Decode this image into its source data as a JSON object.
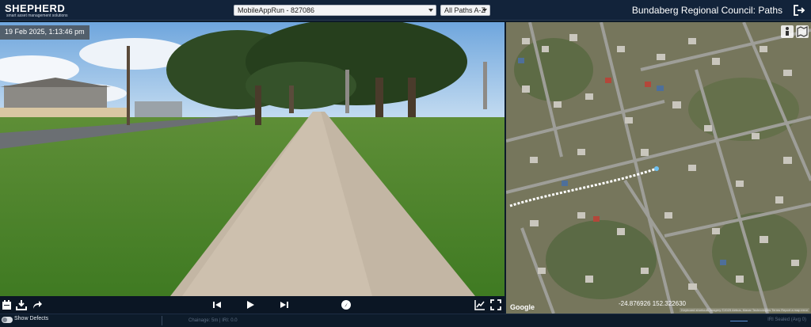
{
  "header": {
    "logo_text": "SHEPHERD",
    "logo_sub": "smart asset management solutions",
    "run_select": "MobileAppRun - 827086",
    "paths_select": "All Paths A-Z",
    "title": "Bundaberg Regional Council:  Paths"
  },
  "video": {
    "timestamp": "19 Feb 2025, 1:13:46 pm"
  },
  "map": {
    "coordinates": "-24.876926  152.322630",
    "google": "Google",
    "attribution": "Keyboard shortcuts  Imagery ©2025 Airbus, Maxar Technologies   Terms   Report a map error"
  },
  "status": {
    "show_defects": "Show Defects",
    "chainage": "Chainage: 5m | IRI: 0.0",
    "iri_legend": "IRI Sealed (Avg 0)"
  },
  "colors": {
    "header_bg": "#12233a",
    "track": "#ffffff"
  }
}
